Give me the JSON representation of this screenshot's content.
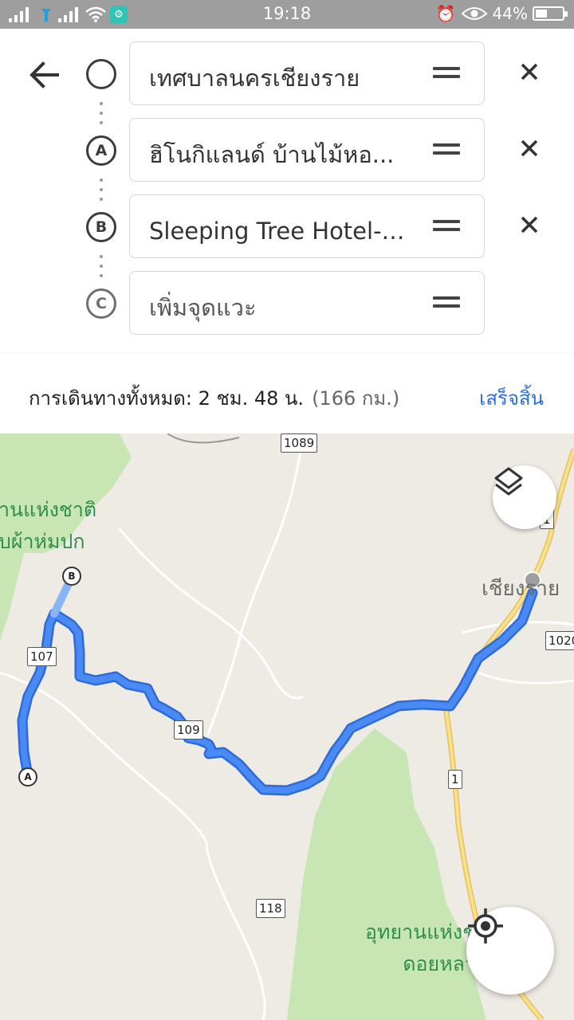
{
  "status_bar": {
    "time": "19:18",
    "battery_percent": "44%",
    "battery_level": 0.44,
    "icons": [
      "signal-icon",
      "wifi-icon",
      "alarm-icon",
      "eye-icon",
      "battery-icon"
    ]
  },
  "directions": {
    "stops": [
      {
        "marker": "",
        "value": "เทศบาลนครเชียงราย",
        "is_placeholder": false,
        "removable": true
      },
      {
        "marker": "A",
        "value": "ฮิโนกิแลนด์ บ้านไม้หอ...",
        "is_placeholder": false,
        "removable": true
      },
      {
        "marker": "B",
        "value": "Sleeping Tree Hotel-โ...",
        "is_placeholder": false,
        "removable": true
      },
      {
        "marker": "C",
        "value": "เพิ่มจุดแวะ",
        "is_placeholder": true,
        "removable": false
      }
    ]
  },
  "summary": {
    "total_label": "การเดินทางทั้งหมด: 2 ชม. 48 น.",
    "distance": "(166 กม.)",
    "done_label": "เสร็จสิ้น"
  },
  "map": {
    "labels": {
      "park_top": [
        "านแห่งชาติ",
        "บผ้าห่มปก"
      ],
      "city": "เชียงราย",
      "park_bottom": [
        "อุทยานแห่งช",
        "ดอยหลว"
      ]
    },
    "route_shields": [
      "1089",
      "107",
      "109",
      "118",
      "1",
      "1",
      "1020"
    ],
    "pins": [
      "A",
      "B"
    ],
    "colors": {
      "route": "#4285f4",
      "route_outline": "#2e6bd6",
      "highway": "#f6d46a",
      "forest": "#c8e6b4",
      "land": "#eeebe5"
    }
  }
}
